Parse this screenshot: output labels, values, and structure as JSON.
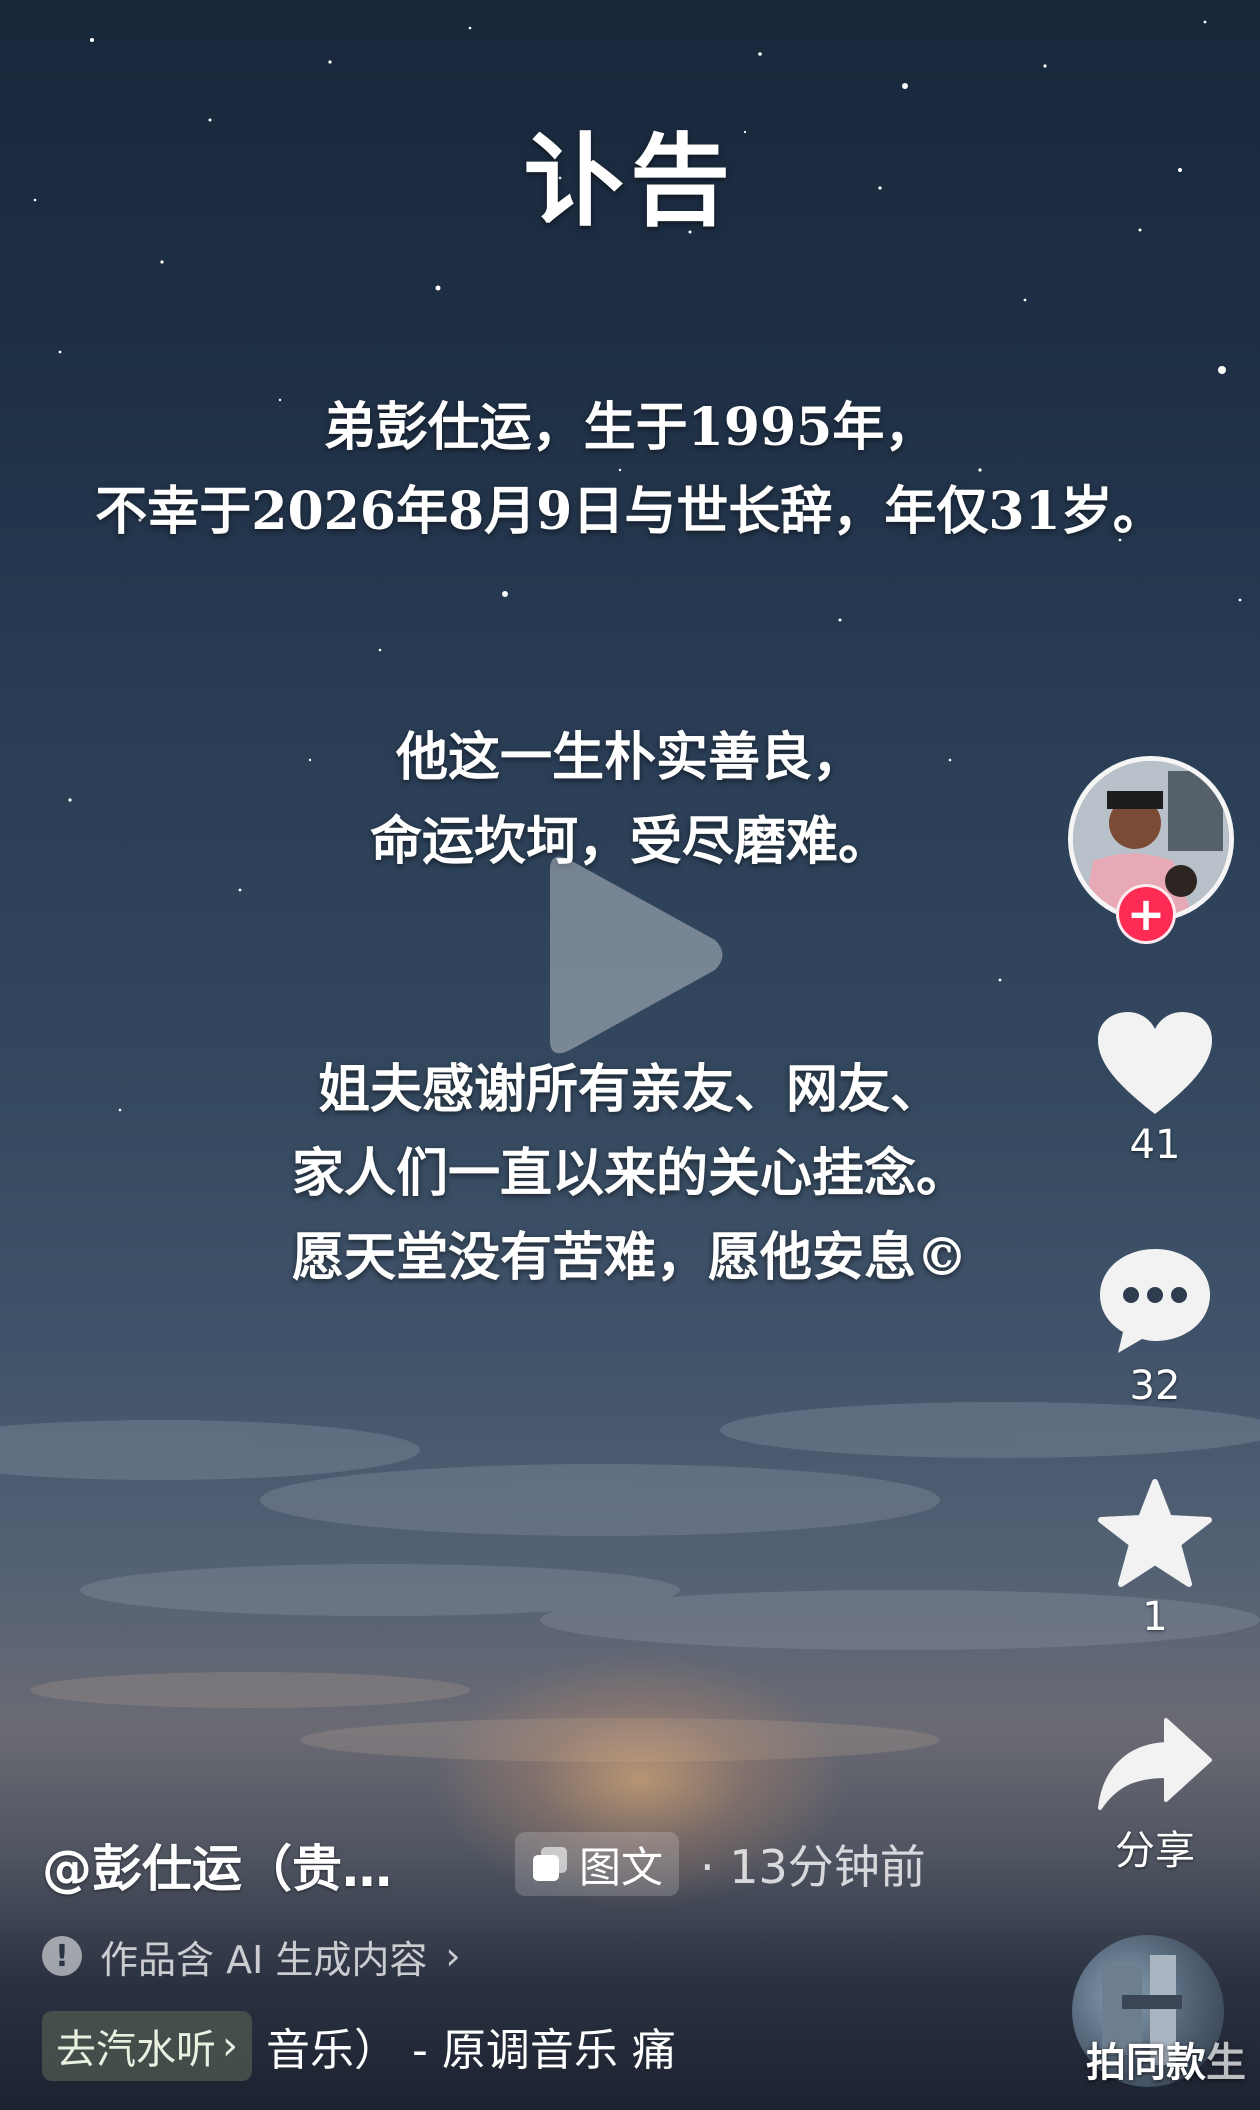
{
  "notice": {
    "title": "讣告",
    "para1": [
      "弟彭仕运，生于1995年，",
      "不幸于2026年8月9日与世长辞，年仅31岁。"
    ],
    "para2": [
      "他这一生朴实善良，",
      "命运坎坷，受尽磨难。"
    ],
    "para3": [
      "姐夫感谢所有亲友、网友、",
      "家人们一直以来的关心挂念。",
      "愿天堂没有苦难，愿他安息©"
    ]
  },
  "actions": {
    "follow_symbol": "+",
    "like_count": "41",
    "comment_count": "32",
    "favorite_count": "1",
    "share_label": "分享"
  },
  "post": {
    "author": "@彭仕运（贵…",
    "type_tag": "图文",
    "time": "· 13分钟前",
    "ai_notice": "作品含 AI 生成内容",
    "ai_arrow": "›",
    "listen_button": "去汽水听",
    "listen_arrow": "›",
    "music_text": "音乐） - 原调音乐    痛",
    "same_style_label": "拍同款",
    "same_style_extra": "生"
  },
  "colors": {
    "follow_red": "#fe2c55",
    "text_white": "#ffffff"
  },
  "icons": [
    "play-icon",
    "heart-icon",
    "comment-icon",
    "star-icon",
    "share-arrow-icon",
    "warning-icon",
    "images-icon"
  ]
}
